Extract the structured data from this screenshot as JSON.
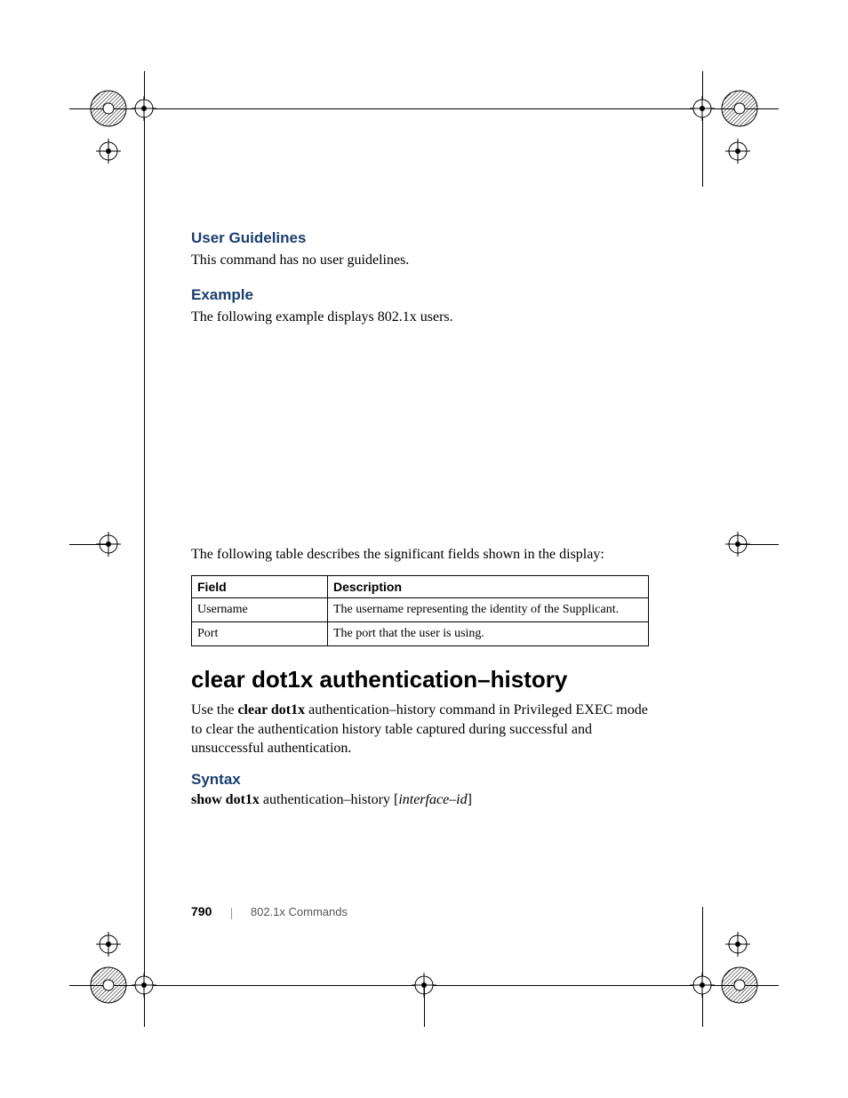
{
  "sections": {
    "user_guidelines": {
      "heading": "User Guidelines",
      "text": "This command has no user guidelines."
    },
    "example": {
      "heading": "Example",
      "text": "The following example displays 802.1x users."
    },
    "table_intro": "The following table describes the significant fields shown in the display:",
    "table": {
      "headers": {
        "field": "Field",
        "description": "Description"
      },
      "rows": [
        {
          "field": "Username",
          "description": "The username representing the identity of the Supplicant."
        },
        {
          "field": "Port",
          "description": "The port that the user is using."
        }
      ]
    },
    "command": {
      "title": "clear dot1x authentication–history",
      "usage_pre": "Use the ",
      "usage_bold": "clear dot1x",
      "usage_post": " authentication–history command in Privileged EXEC mode to clear the authentication history table captured during successful and unsuccessful authentication.",
      "syntax_heading": "Syntax",
      "syntax_bold": "show dot1x",
      "syntax_mid": " authentication–history [",
      "syntax_italic": "interface–id",
      "syntax_end": "]"
    }
  },
  "footer": {
    "page_number": "790",
    "chapter": "802.1x Commands"
  }
}
